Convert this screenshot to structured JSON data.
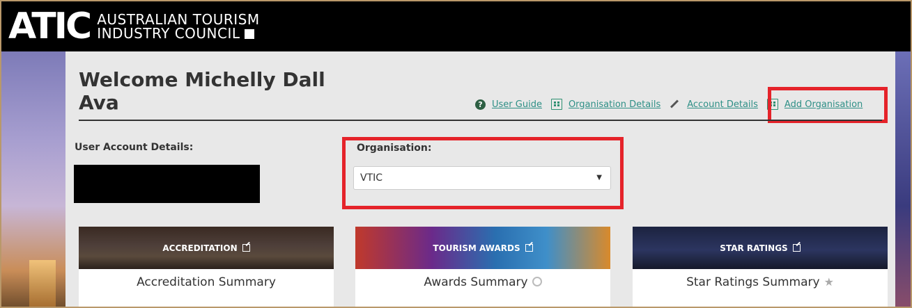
{
  "brand": {
    "mark": "ATIC",
    "line1": "AUSTRALIAN TOURISM",
    "line2": "INDUSTRY COUNCIL"
  },
  "welcome": {
    "line1": "Welcome Michelly Dall",
    "line2": "Ava"
  },
  "links": {
    "user_guide": "User Guide",
    "organisation_details": "Organisation Details",
    "account_details": "Account Details",
    "add_organisation": "Add Organisation"
  },
  "user_account": {
    "label": "User Account Details:"
  },
  "organisation": {
    "label": "Organisation:",
    "selected": "VTIC"
  },
  "cards": [
    {
      "header": "ACCREDITATION",
      "title": "Accreditation Summary"
    },
    {
      "header": "TOURISM AWARDS",
      "title": "Awards Summary"
    },
    {
      "header": "STAR RATINGS",
      "title": "Star Ratings Summary"
    }
  ],
  "colors": {
    "link": "#2e8f86",
    "highlight": "#e5232a",
    "panel": "#e8e8e8",
    "topbar": "#000000"
  },
  "icons": {
    "help": "question-circle-icon",
    "building": "building-icon",
    "pencil": "pencil-icon",
    "add_building": "building-add-icon",
    "external": "external-link-icon",
    "award": "award-ribbon-icon",
    "star": "star-icon"
  }
}
